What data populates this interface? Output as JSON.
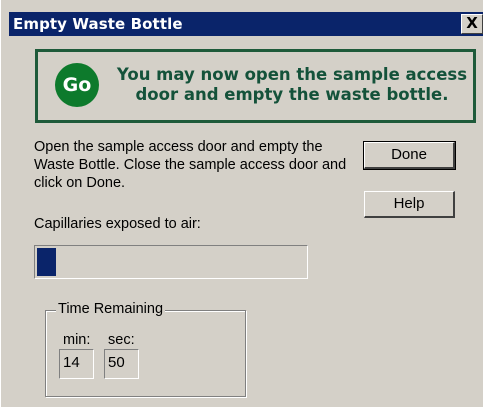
{
  "window": {
    "title": "Empty Waste Bottle",
    "close_label": "X"
  },
  "notice": {
    "icon_label": "Go",
    "icon_color": "#0d7a2c",
    "text_color": "#14523a",
    "message": "You may now open the sample access door and empty the waste bottle."
  },
  "instructions": "Open the sample access door and empty the Waste Bottle. Close the sample access door and click on Done.",
  "buttons": {
    "done": "Done",
    "help": "Help"
  },
  "capillaries": {
    "label": "Capillaries exposed to air:",
    "progress_fraction": 0.07,
    "bar_color": "#0a246a"
  },
  "time_remaining": {
    "legend": "Time Remaining",
    "min_label": "min:",
    "sec_label": "sec:",
    "min_value": "14",
    "sec_value": "50"
  }
}
